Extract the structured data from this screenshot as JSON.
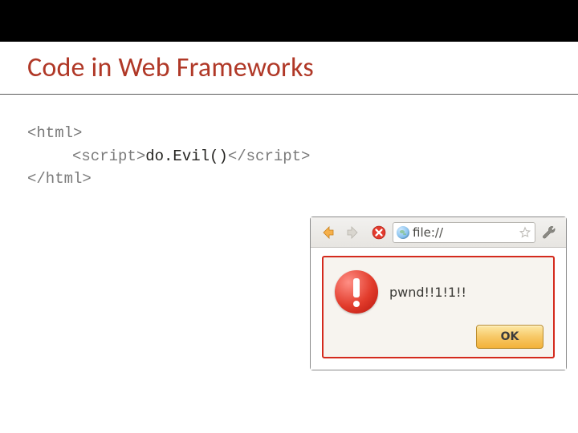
{
  "top_bar": {},
  "title": "Code in Web Frameworks",
  "code": {
    "line1": "<html>",
    "line2_open": "<script>",
    "line2_body": "do.Evil()",
    "line2_close": "</script>",
    "line3": "</html>"
  },
  "browser": {
    "url_scheme": "file://",
    "icons": {
      "back": "back-arrow",
      "forward": "forward-arrow",
      "stop": "stop-x",
      "globe": "globe",
      "star": "star-outline",
      "wrench": "wrench"
    }
  },
  "dialog": {
    "message": "pwnd!!1!1!!",
    "ok_label": "OK",
    "icon": "error-exclamation"
  },
  "colors": {
    "title": "#b03827",
    "dialog_border": "#d42a1d",
    "ok_gradient_top": "#fde9a7",
    "ok_gradient_bottom": "#f3b23a"
  }
}
